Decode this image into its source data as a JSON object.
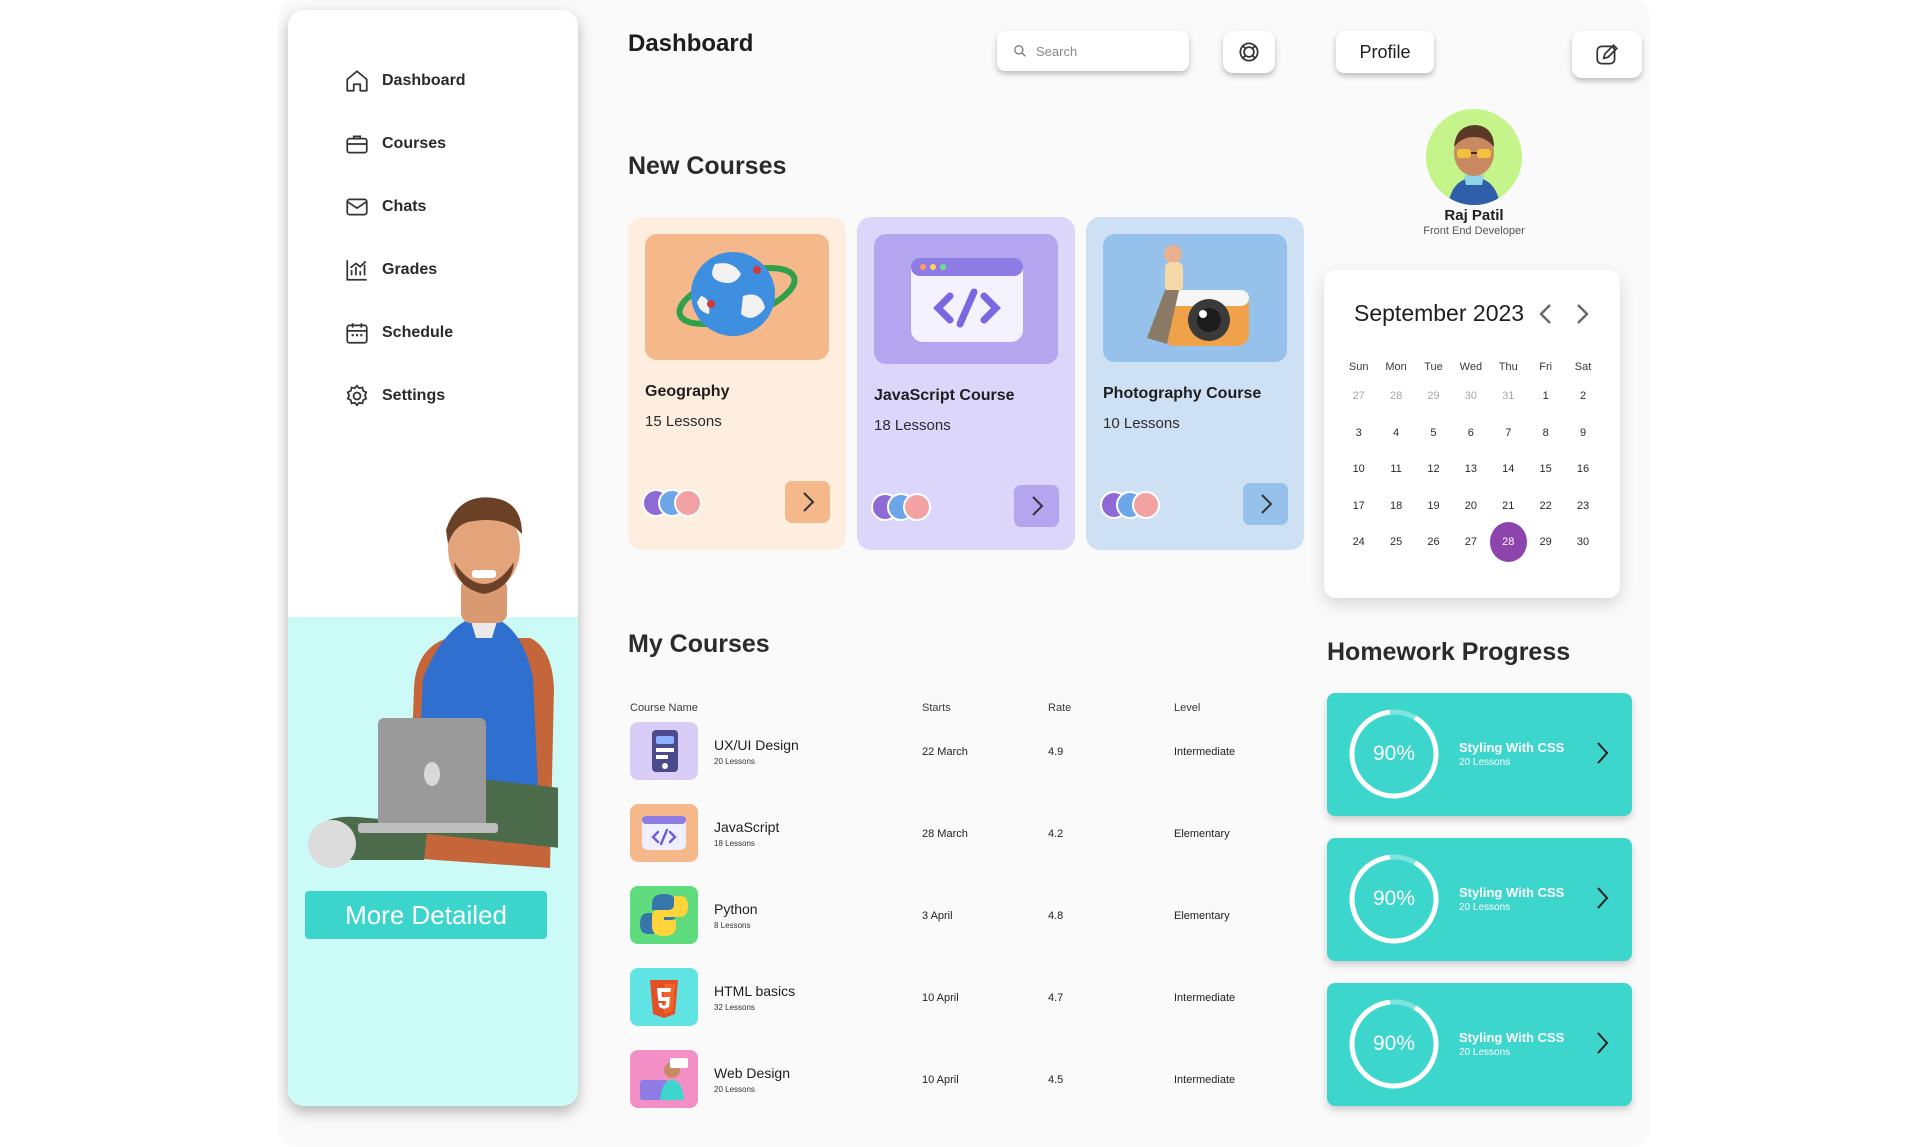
{
  "sidebar": {
    "items": [
      {
        "label": "Dashboard",
        "icon": "home-icon"
      },
      {
        "label": "Courses",
        "icon": "briefcase-icon"
      },
      {
        "label": "Chats",
        "icon": "mail-icon"
      },
      {
        "label": "Grades",
        "icon": "bar-chart-icon"
      },
      {
        "label": "Schedule",
        "icon": "calendar-icon"
      },
      {
        "label": "Settings",
        "icon": "gear-icon"
      }
    ],
    "promo_button": "More Detailed"
  },
  "header": {
    "title": "Dashboard",
    "search_placeholder": "Search",
    "profile_label": "Profile"
  },
  "new_courses": {
    "title": "New Courses",
    "cards": [
      {
        "title": "Geography",
        "lessons": "15 Lessons",
        "bg": "#fdeee0",
        "thumb_bg": "#f4b88a",
        "button_bg": "#f4b88a"
      },
      {
        "title": "JavaScript Course",
        "lessons": "18 Lessons",
        "bg": "#ddd6fb",
        "thumb_bg": "#b3a6ee",
        "button_bg": "#b3a6ee"
      },
      {
        "title": "Photography Course",
        "lessons": "10 Lessons",
        "bg": "#cde0f4",
        "thumb_bg": "#96c1ea",
        "button_bg": "#96c1ea"
      }
    ]
  },
  "profile": {
    "name": "Raj Patil",
    "role": "Front End Developer"
  },
  "calendar": {
    "title": "September 2023",
    "weekdays": [
      "Sun",
      "Mon",
      "Tue",
      "Wed",
      "Thu",
      "Fri",
      "Sat"
    ],
    "weeks": [
      [
        "27",
        "28",
        "29",
        "30",
        "31",
        "1",
        "2"
      ],
      [
        "3",
        "4",
        "5",
        "6",
        "7",
        "8",
        "9"
      ],
      [
        "10",
        "11",
        "12",
        "13",
        "14",
        "15",
        "16"
      ],
      [
        "17",
        "18",
        "19",
        "20",
        "21",
        "22",
        "23"
      ],
      [
        "24",
        "25",
        "26",
        "27",
        "28",
        "29",
        "30"
      ]
    ],
    "selected": "28",
    "selected_color": "#8e44ad"
  },
  "my_courses": {
    "title": "My Courses",
    "columns": [
      "Course Name",
      "Starts",
      "Rate",
      "Level"
    ],
    "rows": [
      {
        "name": "UX/UI Design",
        "lessons": "20 Lessons",
        "starts": "22 March",
        "rate": "4.9",
        "level": "Intermediate",
        "thumb_bg": "#d8cdf6"
      },
      {
        "name": "JavaScript",
        "lessons": "18 Lessons",
        "starts": "28 March",
        "rate": "4.2",
        "level": "Elementary",
        "thumb_bg": "#f4b88a"
      },
      {
        "name": "Python",
        "lessons": "8 Lessons",
        "starts": "3 April",
        "rate": "4.8",
        "level": "Elementary",
        "thumb_bg": "#5fdc7e"
      },
      {
        "name": "HTML basics",
        "lessons": "32 Lessons",
        "starts": "10 April",
        "rate": "4.7",
        "level": "Intermediate",
        "thumb_bg": "#5fe3e3"
      },
      {
        "name": "Web Design",
        "lessons": "20 Lessons",
        "starts": "10 April",
        "rate": "4.5",
        "level": "Intermediate",
        "thumb_bg": "#f28fc4"
      }
    ]
  },
  "homework": {
    "title": "Homework Progress",
    "items": [
      {
        "percent": "90%",
        "progress": 0.9,
        "name": "Styling With CSS",
        "lessons": "20 Lessons"
      },
      {
        "percent": "90%",
        "progress": 0.9,
        "name": "Styling With CSS",
        "lessons": "20 Lessons"
      },
      {
        "percent": "90%",
        "progress": 0.9,
        "name": "Styling With CSS",
        "lessons": "20 Lessons"
      }
    ],
    "color": "#3dd6cc"
  }
}
